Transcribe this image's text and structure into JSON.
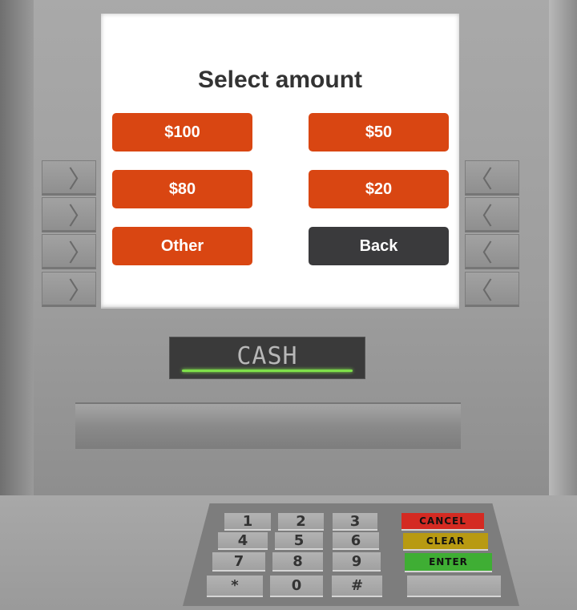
{
  "screen": {
    "title": "Select amount",
    "buttons": [
      {
        "label": "$100"
      },
      {
        "label": "$50"
      },
      {
        "label": "$80"
      },
      {
        "label": "$20"
      },
      {
        "label": "Other"
      },
      {
        "label": "Back"
      }
    ]
  },
  "slot": {
    "label": "CASH"
  },
  "keypad": {
    "keys": [
      "1",
      "2",
      "3",
      "4",
      "5",
      "6",
      "7",
      "8",
      "9",
      "*",
      "0",
      "#"
    ],
    "cancel": "CANCEL",
    "clear": "CLEAR",
    "enter": "ENTER"
  },
  "colors": {
    "accent": "#d94612",
    "back": "#3a3a3c",
    "cancel": "#d42a22",
    "clear": "#b89a12",
    "enter": "#3fae34",
    "indicator": "#7ee04a"
  }
}
